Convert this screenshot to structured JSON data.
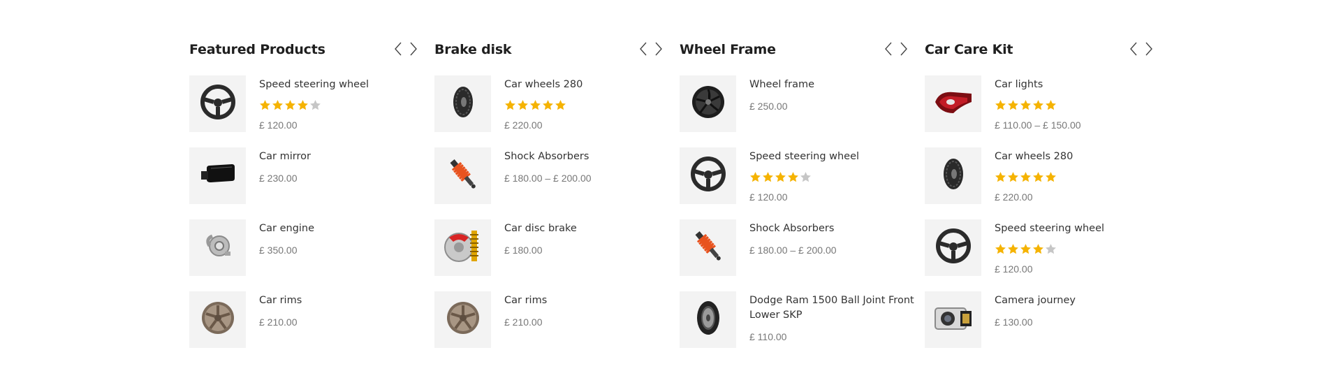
{
  "currency": "£",
  "colors": {
    "star_filled": "#f5b301",
    "star_empty": "#c6c6c6",
    "thumb_bg": "#f3f3f3"
  },
  "columns": [
    {
      "title": "Featured Products",
      "products": [
        {
          "name": "Speed steering wheel",
          "rating": 4,
          "price": "£ 120.00",
          "icon": "steering-wheel"
        },
        {
          "name": "Car mirror",
          "rating": null,
          "price": "£ 230.00",
          "icon": "car-mirror"
        },
        {
          "name": "Car engine",
          "rating": null,
          "price": "£ 350.00",
          "icon": "turbo-engine"
        },
        {
          "name": "Car rims",
          "rating": null,
          "price": "£ 210.00",
          "icon": "rim"
        }
      ]
    },
    {
      "title": "Brake disk",
      "products": [
        {
          "name": "Car wheels 280",
          "rating": 5,
          "price": "£ 220.00",
          "icon": "tire"
        },
        {
          "name": "Shock Absorbers",
          "rating": null,
          "price": "£ 180.00 – £ 200.00",
          "icon": "shock-absorber"
        },
        {
          "name": "Car disc brake",
          "rating": null,
          "price": "£ 180.00",
          "icon": "disc-brake"
        },
        {
          "name": "Car rims",
          "rating": null,
          "price": "£ 210.00",
          "icon": "rim"
        }
      ]
    },
    {
      "title": "Wheel Frame",
      "products": [
        {
          "name": "Wheel frame",
          "rating": null,
          "price": "£ 250.00",
          "icon": "sport-rim"
        },
        {
          "name": "Speed steering wheel",
          "rating": 4,
          "price": "£ 120.00",
          "icon": "steering-wheel"
        },
        {
          "name": "Shock Absorbers",
          "rating": null,
          "price": "£ 180.00 – £ 200.00",
          "icon": "shock-absorber"
        },
        {
          "name": "Dodge Ram 1500 Ball Joint Front Lower SKP",
          "rating": null,
          "price": "£ 110.00",
          "icon": "tire-side"
        }
      ]
    },
    {
      "title": "Car Care Kit",
      "products": [
        {
          "name": "Car lights",
          "rating": 5,
          "price": "£ 110.00 – £ 150.00",
          "icon": "tail-light"
        },
        {
          "name": "Car wheels 280",
          "rating": 5,
          "price": "£ 220.00",
          "icon": "tire"
        },
        {
          "name": "Speed steering wheel",
          "rating": 4,
          "price": "£ 120.00",
          "icon": "steering-wheel"
        },
        {
          "name": "Camera journey",
          "rating": null,
          "price": "£ 130.00",
          "icon": "dash-camera"
        }
      ]
    }
  ]
}
